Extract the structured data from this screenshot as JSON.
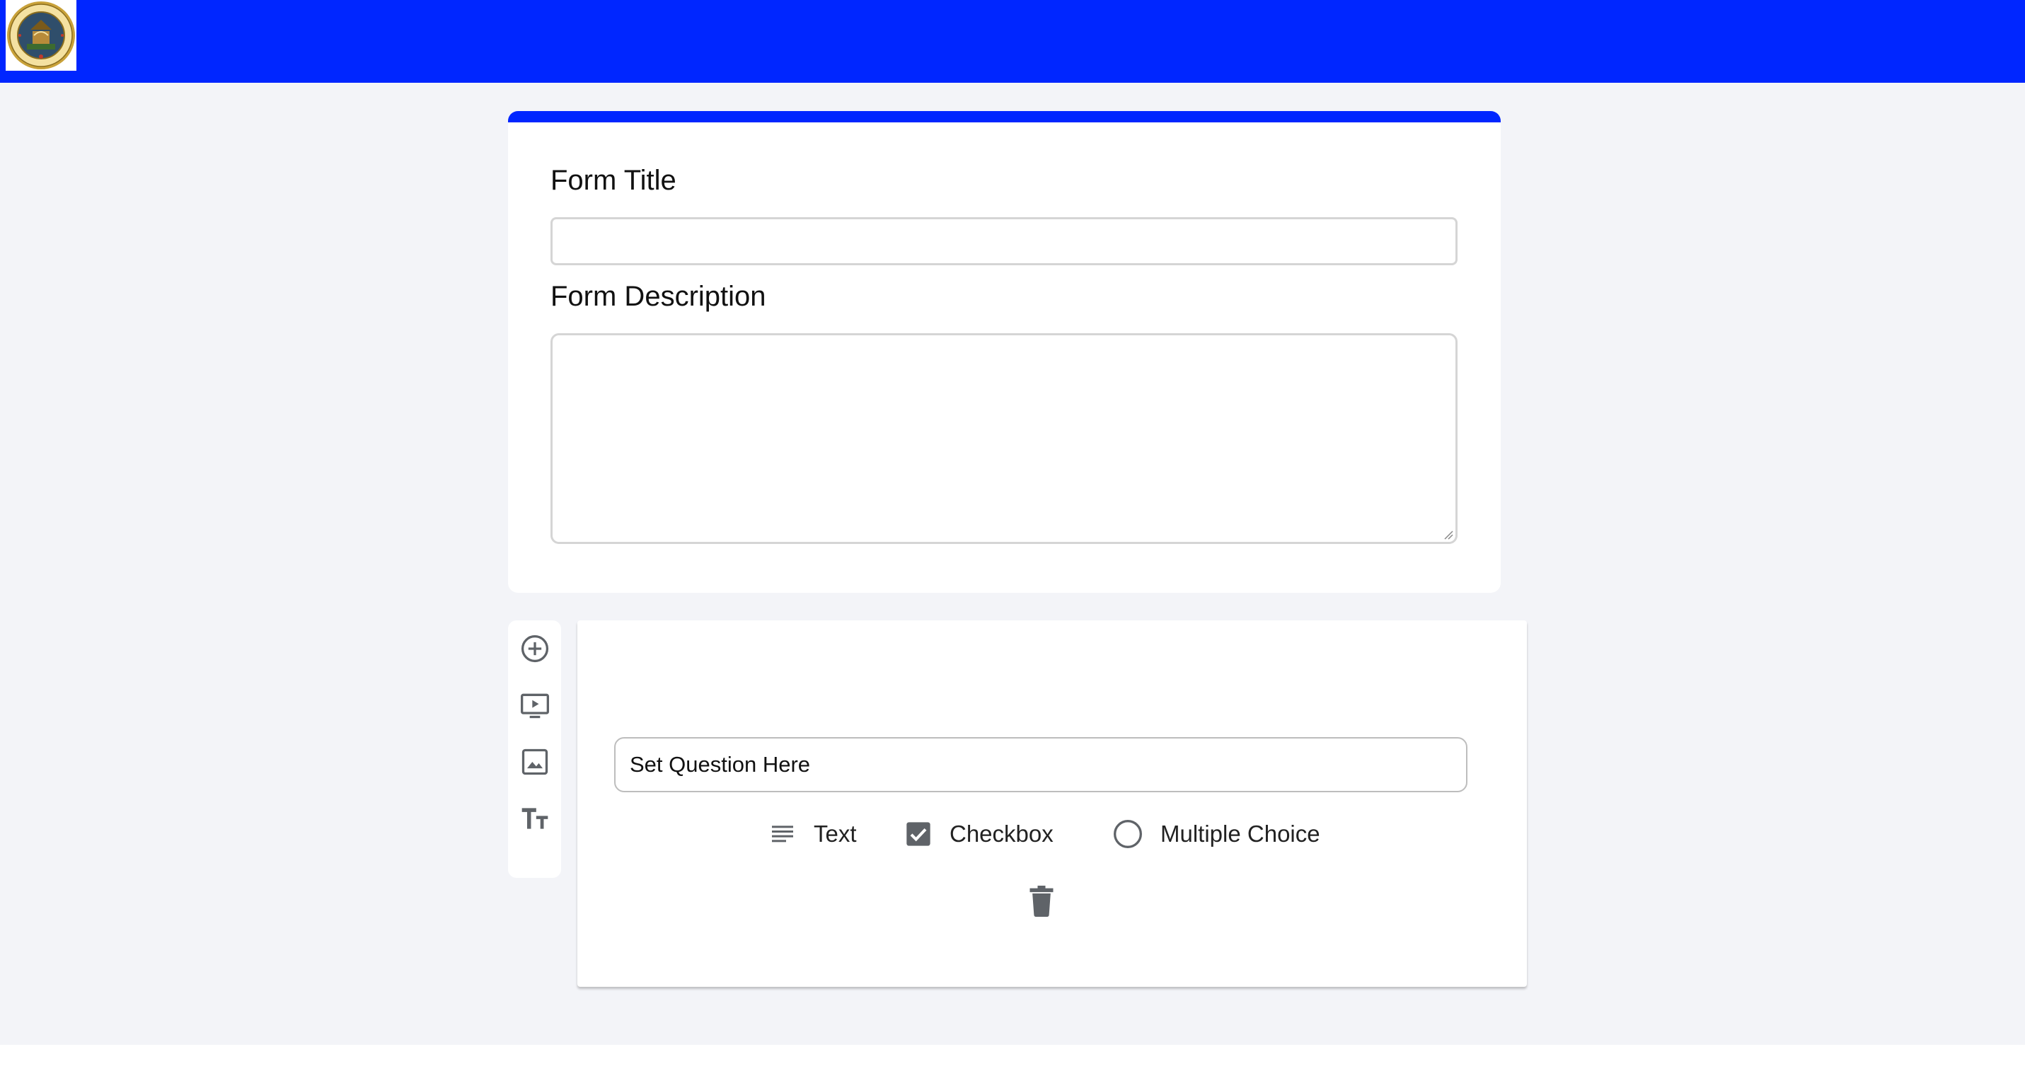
{
  "form": {
    "title_label": "Form Title",
    "title_value": "",
    "description_label": "Form Description",
    "description_value": ""
  },
  "sidebar": {
    "tools": [
      {
        "icon": "add-circle-icon"
      },
      {
        "icon": "video-icon"
      },
      {
        "icon": "image-icon"
      },
      {
        "icon": "text-size-icon"
      }
    ]
  },
  "question": {
    "input_value": "Set Question Here",
    "types": [
      {
        "label": "Text",
        "icon": "text-lines-icon"
      },
      {
        "label": "Checkbox",
        "icon": "checkbox-checked-icon"
      },
      {
        "label": "Multiple Choice",
        "icon": "radio-unchecked-icon"
      }
    ],
    "delete_icon": "trash-icon"
  },
  "colors": {
    "header": "#0026ff",
    "accent": "#0026ff",
    "page_background": "#f3f4f8",
    "icon_gray": "#5f6368"
  }
}
